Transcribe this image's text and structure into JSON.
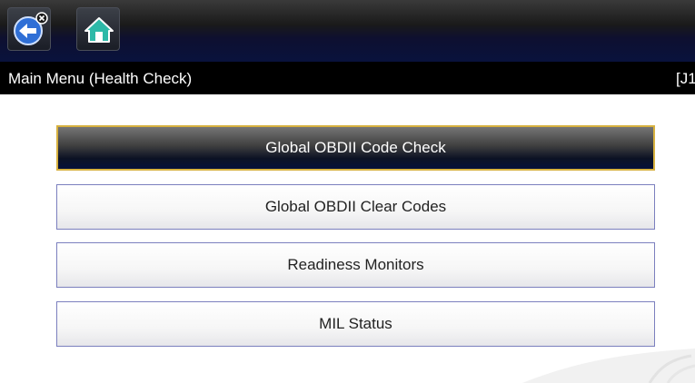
{
  "toolbar": {
    "back_icon": "back-arrow-icon",
    "close_badge_icon": "close-badge-icon",
    "home_icon": "home-icon",
    "accent_color": "#2f6fd6",
    "home_color": "#2db9a8"
  },
  "title_bar": {
    "title": "Main Menu (Health Check)",
    "vehicle_id": "[J1"
  },
  "menu": {
    "selected_border_color": "#d7b13f",
    "button_border_color": "#7b7fbe",
    "items": [
      {
        "label": "Global OBDII Code Check",
        "selected": true
      },
      {
        "label": "Global OBDII Clear Codes",
        "selected": false
      },
      {
        "label": "Readiness Monitors",
        "selected": false
      },
      {
        "label": "MIL Status",
        "selected": false
      }
    ]
  }
}
